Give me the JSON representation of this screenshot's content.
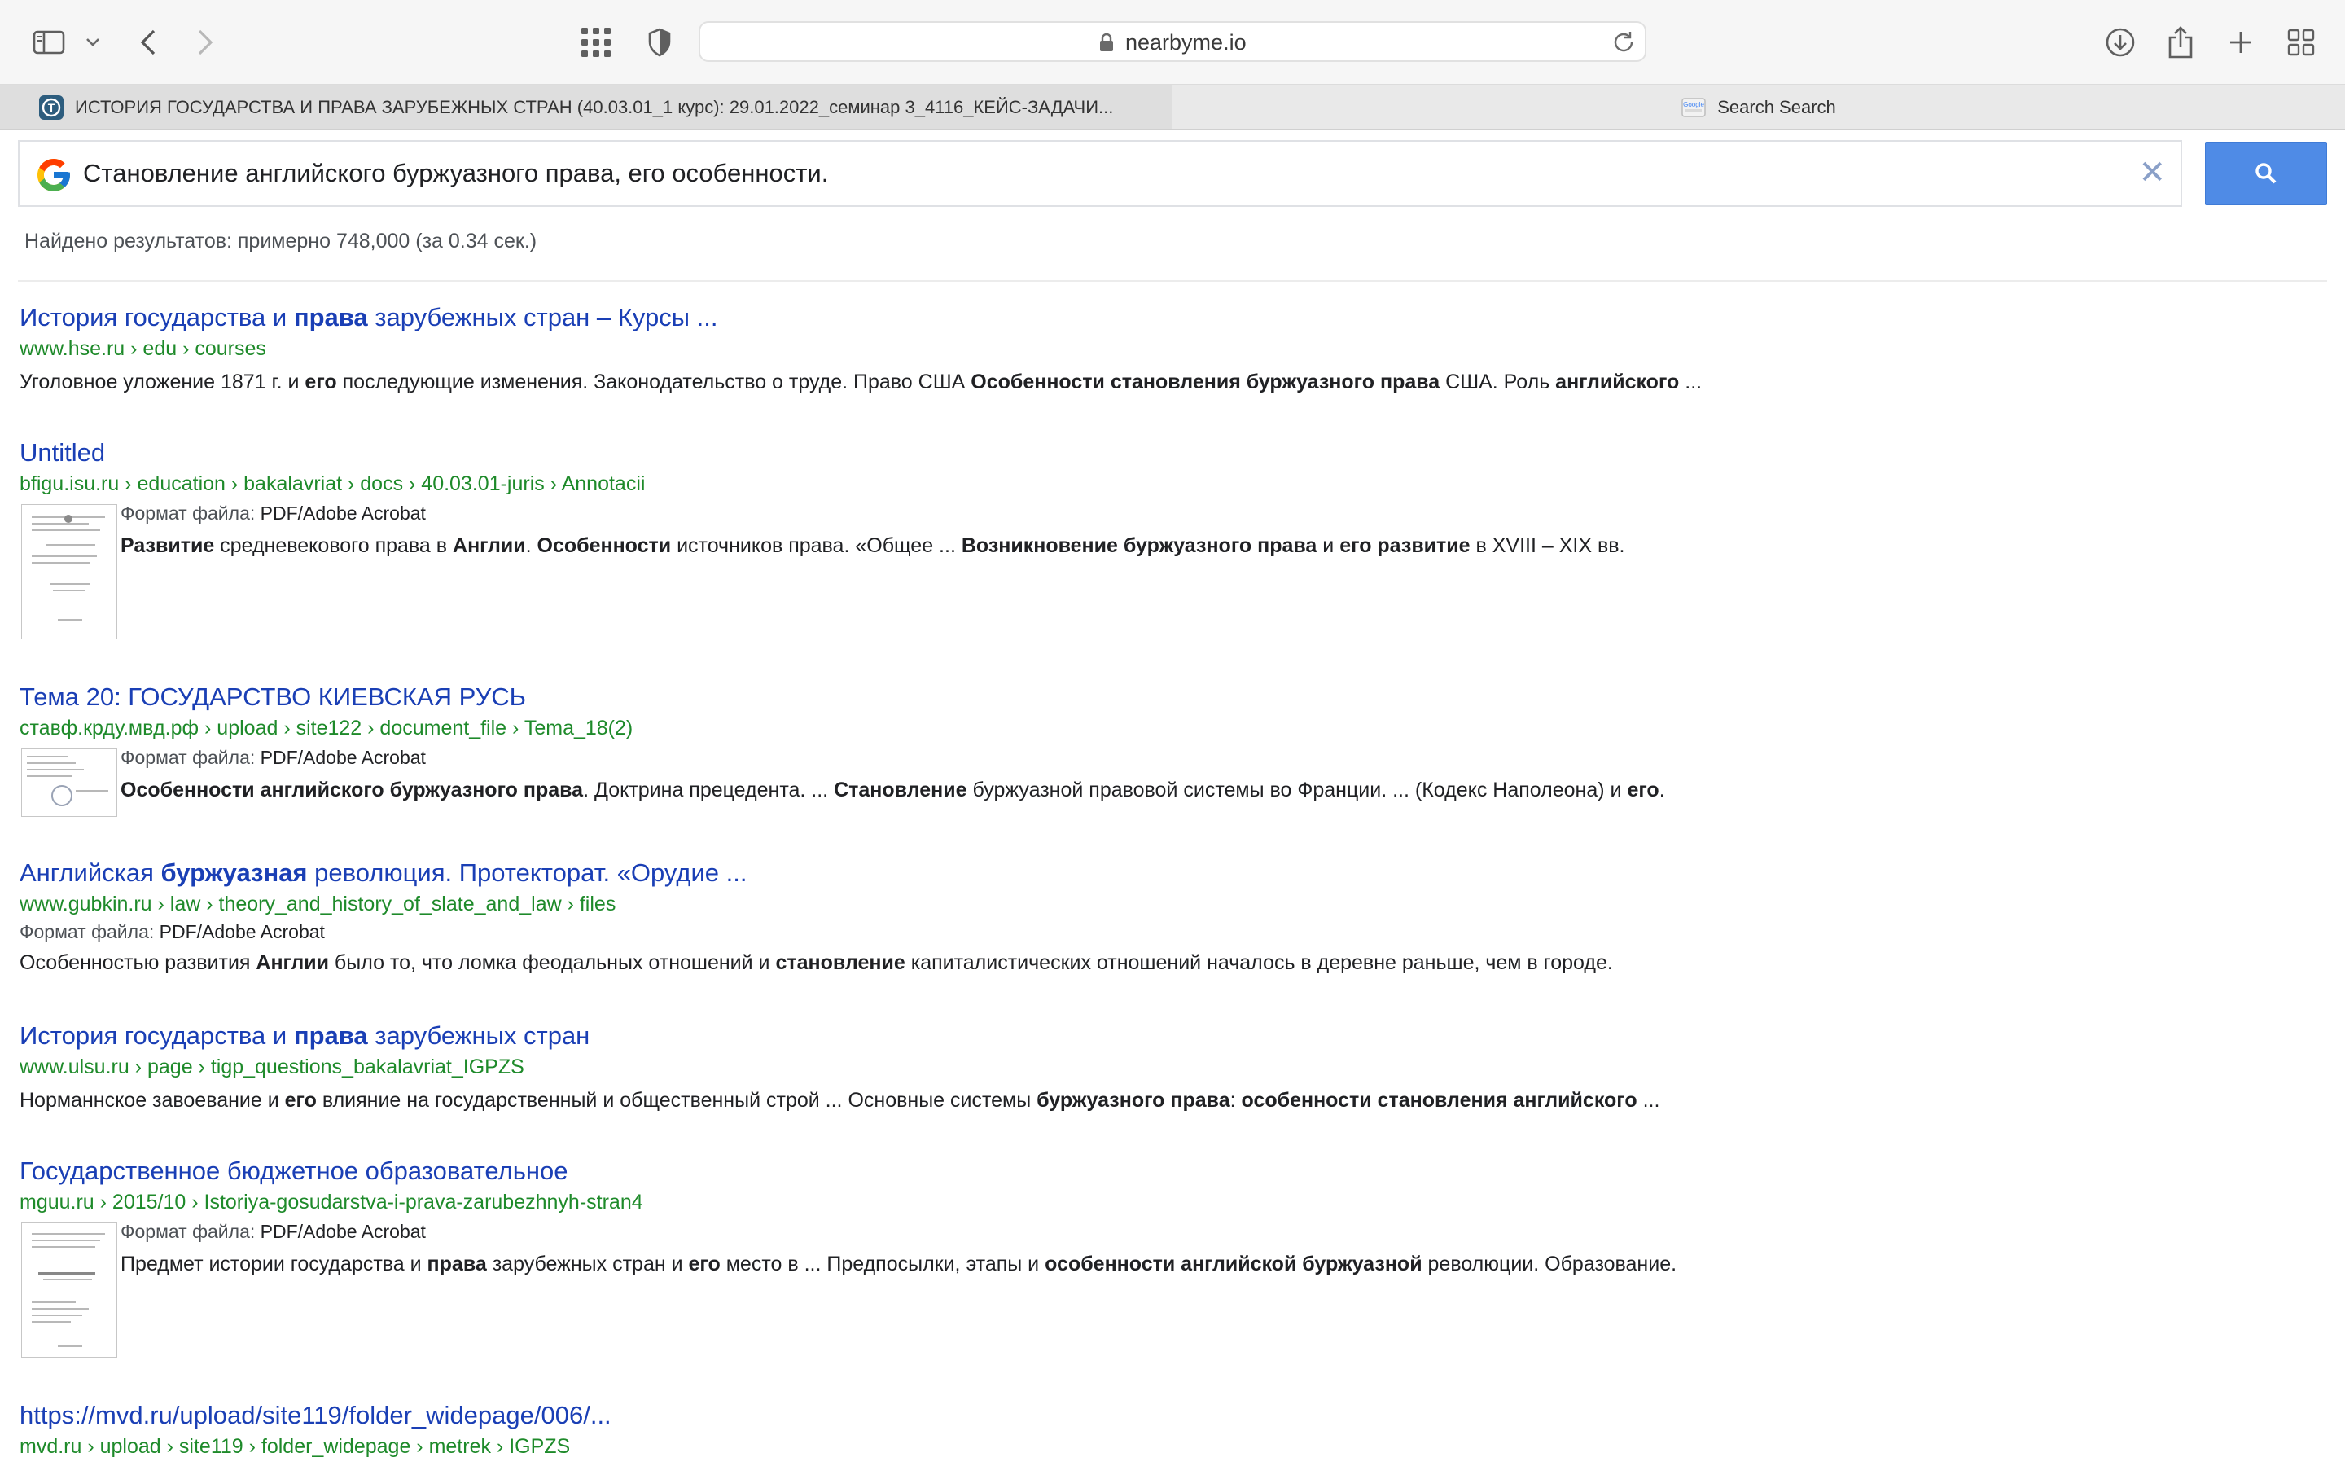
{
  "browser": {
    "url": "nearbyme.io",
    "tabs": [
      {
        "label": "ИСТОРИЯ ГОСУДАРСТВА И ПРАВА ЗАРУБЕЖНЫХ СТРАН (40.03.01_1 курс): 29.01.2022_семинар 3_4116_КЕЙС-ЗАДАЧИ..."
      },
      {
        "label": "Search Search"
      }
    ]
  },
  "search": {
    "query": "Становление английского буржуазного права, его особенности.",
    "stats": "Найдено результатов: примерно 748,000 (за 0.34 сек.)"
  },
  "results": [
    {
      "title": [
        {
          "t": "История государства и ",
          "b": false
        },
        {
          "t": "права",
          "b": true
        },
        {
          "t": " зарубежных стран – Курсы ...",
          "b": false
        }
      ],
      "url": "www.hse.ru › edu › courses",
      "snippet": [
        {
          "t": "Уголовное уложение 1871 г. и ",
          "b": false
        },
        {
          "t": "его",
          "b": true
        },
        {
          "t": " последующие изменения. Законодательство о труде. Право США ",
          "b": false
        },
        {
          "t": "Особенности становления буржуазного права",
          "b": true
        },
        {
          "t": " США. Роль ",
          "b": false
        },
        {
          "t": "английского",
          "b": true
        },
        {
          "t": " ...",
          "b": false
        }
      ]
    },
    {
      "title": [
        {
          "t": "Untitled",
          "b": false
        }
      ],
      "url": "bfigu.isu.ru › education › bakalavriat › docs › 40.03.01-juris › Annotacii",
      "format_label": "Формат файла: ",
      "format_value": "PDF/Adobe Acrobat",
      "snippet": [
        {
          "t": "Развитие",
          "b": true
        },
        {
          "t": " средневекового права в ",
          "b": false
        },
        {
          "t": "Англии",
          "b": true
        },
        {
          "t": ". ",
          "b": false
        },
        {
          "t": "Особенности",
          "b": true
        },
        {
          "t": " источников права. «Общее ... ",
          "b": false
        },
        {
          "t": "Возникновение буржуазного права",
          "b": true
        },
        {
          "t": " и ",
          "b": false
        },
        {
          "t": "его развитие",
          "b": true
        },
        {
          "t": " в XVIII – XIX вв.",
          "b": false
        }
      ]
    },
    {
      "title": [
        {
          "t": "Тема 20: ГОСУДАРСТВО КИЕВСКАЯ РУСЬ",
          "b": false
        }
      ],
      "url": "ставф.крду.мвд.рф › upload › site122 › document_file › Tema_18(2)",
      "format_label": "Формат файла: ",
      "format_value": "PDF/Adobe Acrobat",
      "snippet": [
        {
          "t": "Особенности английского буржуазного права",
          "b": true
        },
        {
          "t": ". Доктрина прецедента. ... ",
          "b": false
        },
        {
          "t": "Становление",
          "b": true
        },
        {
          "t": " буржуазной правовой системы во Франции. ... (Кодекс Наполеона) и ",
          "b": false
        },
        {
          "t": "его",
          "b": true
        },
        {
          "t": ".",
          "b": false
        }
      ]
    },
    {
      "title": [
        {
          "t": "Английская ",
          "b": false
        },
        {
          "t": "буржуазная",
          "b": true
        },
        {
          "t": " революция. Протекторат. «Орудие ...",
          "b": false
        }
      ],
      "url": "www.gubkin.ru › law › theory_and_history_of_slate_and_law › files",
      "format_label": "Формат файла: ",
      "format_value": "PDF/Adobe Acrobat",
      "snippet": [
        {
          "t": "Особенностью развития ",
          "b": false
        },
        {
          "t": "Англии",
          "b": true
        },
        {
          "t": " было то, что ломка феодальных отношений и ",
          "b": false
        },
        {
          "t": "становление",
          "b": true
        },
        {
          "t": " капиталистических отношений началось в деревне раньше, чем в городе.",
          "b": false
        }
      ]
    },
    {
      "title": [
        {
          "t": "История государства и ",
          "b": false
        },
        {
          "t": "права",
          "b": true
        },
        {
          "t": " зарубежных стран",
          "b": false
        }
      ],
      "url": "www.ulsu.ru › page › tigp_questions_bakalavriat_IGPZS",
      "snippet": [
        {
          "t": "Норманнское завоевание и ",
          "b": false
        },
        {
          "t": "его",
          "b": true
        },
        {
          "t": " влияние на государственный и общественный строй ... Основные системы ",
          "b": false
        },
        {
          "t": "буржуазного права",
          "b": true
        },
        {
          "t": ": ",
          "b": false
        },
        {
          "t": "особенности становления английского",
          "b": true
        },
        {
          "t": " ...",
          "b": false
        }
      ]
    },
    {
      "title": [
        {
          "t": "Государственное бюджетное образовательное",
          "b": false
        }
      ],
      "url": "mguu.ru › 2015/10 › Istoriya-gosudarstva-i-prava-zarubezhnyh-stran4",
      "format_label": "Формат файла: ",
      "format_value": "PDF/Adobe Acrobat",
      "snippet": [
        {
          "t": "Предмет истории государства и ",
          "b": false
        },
        {
          "t": "права",
          "b": true
        },
        {
          "t": " зарубежных стран и ",
          "b": false
        },
        {
          "t": "его",
          "b": true
        },
        {
          "t": " место в ... Предпосылки, этапы и ",
          "b": false
        },
        {
          "t": "особенности английской буржуазной",
          "b": true
        },
        {
          "t": " революции. Образование.",
          "b": false
        }
      ]
    },
    {
      "title": [
        {
          "t": "https://mvd.ru/upload/site119/folder_widepage/006/...",
          "b": false
        }
      ],
      "url": "mvd.ru › upload › site119 › folder_widepage › metrek › IGPZS"
    }
  ],
  "colors": {
    "link": "#1a3fb5",
    "url_green": "#1e8a2a",
    "search_button": "#4f8be6"
  },
  "icons": [
    "sidebar-icon",
    "chevron-down-icon",
    "back-icon",
    "forward-icon",
    "grid-icon",
    "shield-icon",
    "lock-icon",
    "reload-icon",
    "download-icon",
    "share-icon",
    "new-tab-icon",
    "tab-overview-icon",
    "google-logo-icon",
    "close-icon",
    "search-icon"
  ]
}
